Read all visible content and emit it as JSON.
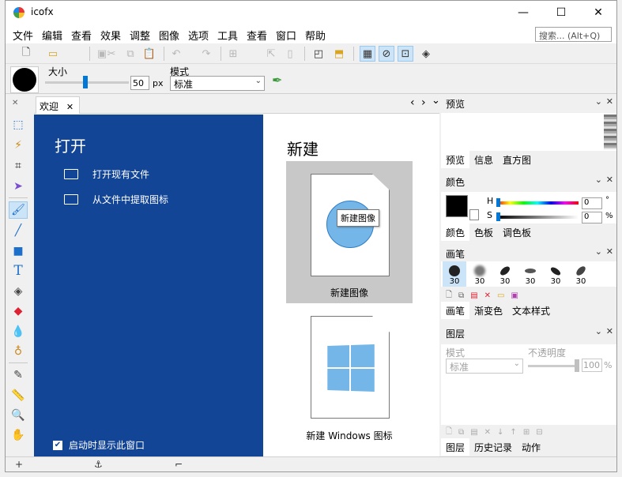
{
  "window": {
    "title": "icofx",
    "controls": {
      "minimize": "—",
      "maximize": "☐",
      "close": "✕"
    }
  },
  "menu": {
    "items": [
      "文件",
      "编辑",
      "查看",
      "效果",
      "调整",
      "图像",
      "选项",
      "工具",
      "查看",
      "窗口",
      "帮助"
    ],
    "search_placeholder": "搜索... (Alt+Q)"
  },
  "toolbar": {
    "icons": [
      "new-file-icon",
      "open-folder-icon",
      "save-icon",
      "cut-icon",
      "copy-icon",
      "paste-icon",
      "undo-icon",
      "redo-icon",
      "windows-logo-icon",
      "apple-logo-icon",
      "cursor-icon",
      "phone-icon",
      "frame-icon",
      "import-icon",
      "checkerboard-icon",
      "no-grid-icon",
      "pixel-grid-icon",
      "layers-icon"
    ]
  },
  "brush_props": {
    "size_label": "大小",
    "size_value": "50",
    "size_unit": "px",
    "size_fraction": 0.5,
    "mode_label": "模式",
    "mode_value": "标准"
  },
  "tools": [
    "selection-tool",
    "magic-wand-tool",
    "crop-tool",
    "move-tool",
    "brush-tool",
    "line-tool",
    "rectangle-tool",
    "text-tool",
    "fill-tool",
    "eraser-tool",
    "blur-tool",
    "dodge-tool",
    "eyedropper-tool",
    "ruler-tool",
    "zoom-tool",
    "hand-tool"
  ],
  "document": {
    "tab_label": "欢迎",
    "tab_close": "✕",
    "nav": {
      "prev": "‹",
      "next": "›",
      "menu": "⌄"
    },
    "open_section": {
      "title": "打开",
      "items": [
        "打开现有文件",
        "从文件中提取图标"
      ]
    },
    "new_section": {
      "title": "新建",
      "new_image_label": "新建图像",
      "new_image_tooltip": "新建图像",
      "new_windows_label": "新建 Windows 图标"
    },
    "startup_label": "启动时显示此窗口",
    "startup_checked": true
  },
  "panels": {
    "preview": {
      "title": "预览",
      "tabs": [
        "预览",
        "信息",
        "直方图"
      ],
      "active_tab": 0
    },
    "colors": {
      "title": "颜色",
      "h_label": "H",
      "h_value": "0",
      "h_unit": "°",
      "s_label": "S",
      "s_value": "0",
      "s_unit": "%",
      "primary_color": "#000000",
      "secondary_color": "#ffffff",
      "tabs": [
        "颜色",
        "色板",
        "调色板"
      ],
      "active_tab": 0
    },
    "brushes": {
      "title": "画笔",
      "sizes": [
        "30",
        "30",
        "30",
        "30",
        "30",
        "30"
      ],
      "tabs": [
        "画笔",
        "渐变色",
        "文本样式"
      ],
      "active_tab": 0
    },
    "layers": {
      "title": "图层",
      "mode_label": "模式",
      "mode_value": "标准",
      "opacity_label": "不透明度",
      "opacity_value": "100",
      "opacity_unit": "%",
      "tabs": [
        "图层",
        "历史记录",
        "动作"
      ],
      "active_tab": 0
    },
    "ctrl": {
      "collapse": "⌄",
      "close": "✕"
    }
  },
  "status": {
    "add": "+",
    "anchor": "⚓",
    "corner": "⌐"
  },
  "colors": {
    "accent": "#0078d7",
    "welcome_bg": "#134597",
    "card_bg": "#c8c8c8",
    "icon_blue": "#75b6e8"
  }
}
